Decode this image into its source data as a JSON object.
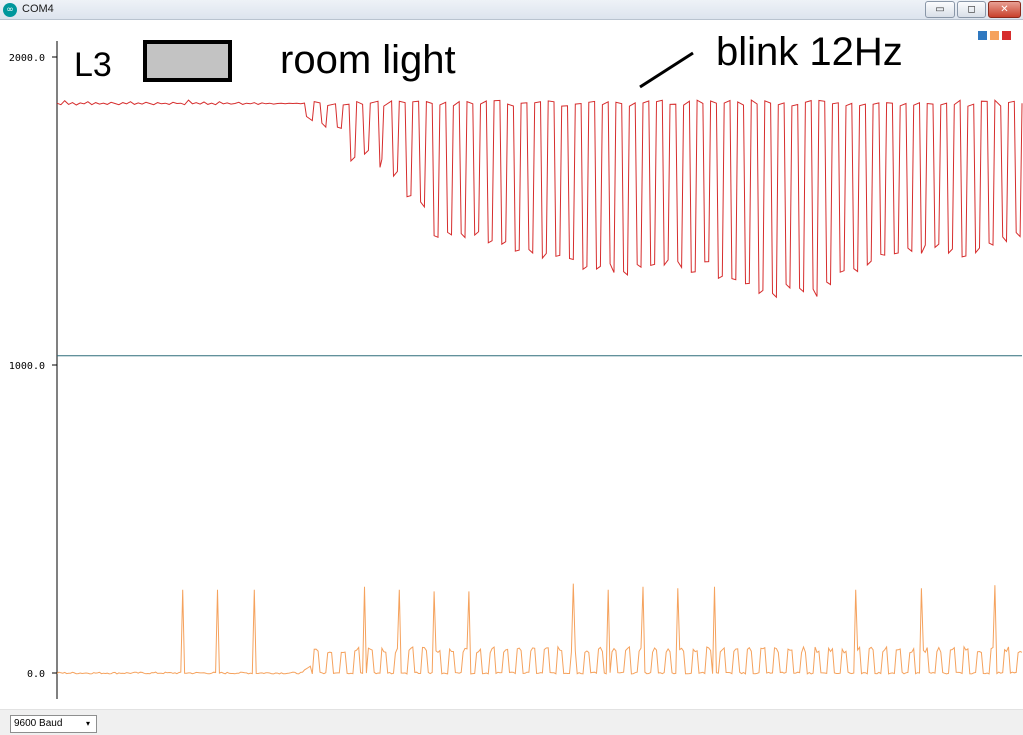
{
  "window": {
    "title": "COM4",
    "minimize_glyph": "▭",
    "maximize_glyph": "◻",
    "close_glyph": "✕"
  },
  "colors": {
    "titlebar": "#dde4ee",
    "series_red": "#d62d2d",
    "series_orange": "#f5a25d",
    "series_blue": "#2f78c0",
    "midline": "#2f6d7a",
    "swatch_fill": "#c3c3c3"
  },
  "icons": [
    "arduino-icon",
    "minimize-icon",
    "maximize-icon",
    "close-icon",
    "dropdown-arrow-icon"
  ],
  "annotations": {
    "label_l3": "L3",
    "room_light": "room light",
    "blink": "blink 12Hz"
  },
  "footer": {
    "baud": "9600 Baud",
    "arrow": "▾"
  },
  "chart_data": {
    "type": "line",
    "title": "",
    "xlabel": "",
    "ylabel": "",
    "ylim": [
      -80,
      2040
    ],
    "xlim": [
      0,
      499
    ],
    "yticks": [
      0,
      1000,
      2000
    ],
    "ytick_labels": [
      "0.0",
      "1000.0",
      "2000.0"
    ],
    "horizontal_lines": [
      1030
    ],
    "legend": {
      "placement": "top-right",
      "colors": [
        "#2f78c0",
        "#f5a25d",
        "#d62d2d"
      ]
    },
    "grid": false,
    "series": [
      {
        "color": "#d62d2d",
        "segments": [
          [
            0,
            1850
          ],
          [
            2,
            1845
          ],
          [
            4,
            1858
          ],
          [
            6,
            1846
          ],
          [
            8,
            1852
          ],
          [
            10,
            1844
          ],
          [
            12,
            1851
          ],
          [
            14,
            1848
          ],
          [
            16,
            1855
          ],
          [
            18,
            1845
          ],
          [
            20,
            1852
          ],
          [
            22,
            1847
          ],
          [
            24,
            1850
          ],
          [
            26,
            1846
          ],
          [
            28,
            1853
          ],
          [
            30,
            1849
          ],
          [
            32,
            1845
          ],
          [
            34,
            1852
          ],
          [
            36,
            1848
          ],
          [
            38,
            1855
          ],
          [
            40,
            1846
          ],
          [
            42,
            1851
          ],
          [
            44,
            1847
          ],
          [
            46,
            1853
          ],
          [
            48,
            1849
          ],
          [
            50,
            1845
          ],
          [
            52,
            1852
          ],
          [
            54,
            1848
          ],
          [
            56,
            1850
          ],
          [
            58,
            1846
          ],
          [
            60,
            1853
          ],
          [
            62,
            1849
          ],
          [
            64,
            1850
          ],
          [
            66,
            1845
          ],
          [
            68,
            1860
          ],
          [
            70,
            1848
          ],
          [
            72,
            1852
          ],
          [
            74,
            1847
          ],
          [
            76,
            1854
          ],
          [
            78,
            1846
          ],
          [
            80,
            1850
          ],
          [
            82,
            1845
          ],
          [
            84,
            1855
          ],
          [
            86,
            1848
          ],
          [
            88,
            1851
          ],
          [
            90,
            1847
          ],
          [
            92,
            1849
          ],
          [
            94,
            1853
          ],
          [
            96,
            1846
          ],
          [
            98,
            1850
          ],
          [
            100,
            1848
          ],
          [
            102,
            1852
          ],
          [
            104,
            1846
          ],
          [
            106,
            1851
          ],
          [
            108,
            1848
          ],
          [
            110,
            1850
          ],
          [
            112,
            1847
          ],
          [
            114,
            1849
          ],
          [
            116,
            1850
          ],
          [
            118,
            1848
          ],
          [
            120,
            1850
          ],
          [
            122,
            1849
          ],
          [
            124,
            1850
          ],
          [
            126,
            1848
          ]
        ],
        "bursts": {
          "comment_free_structure": "each burst = [x_start, x_end, low_value]",
          "list": [
            [
              128,
              133,
              1790
            ],
            [
              136,
              140,
              1770
            ],
            [
              144,
              148,
              1760
            ],
            [
              151,
              155,
              1660
            ],
            [
              158,
              162,
              1680
            ],
            [
              166,
              169,
              1640
            ],
            [
              173,
              177,
              1600
            ],
            [
              180,
              184,
              1530
            ],
            [
              187,
              191,
              1500
            ],
            [
              194,
              198,
              1410
            ],
            [
              201,
              205,
              1420
            ],
            [
              208,
              212,
              1400
            ],
            [
              215,
              219,
              1410
            ],
            [
              222,
              226,
              1390
            ],
            [
              229,
              233,
              1380
            ],
            [
              236,
              240,
              1360
            ],
            [
              243,
              247,
              1350
            ],
            [
              250,
              254,
              1340
            ],
            [
              257,
              261,
              1330
            ],
            [
              264,
              268,
              1320
            ],
            [
              271,
              275,
              1310
            ],
            [
              278,
              282,
              1300
            ],
            [
              285,
              289,
              1300
            ],
            [
              292,
              296,
              1290
            ],
            [
              299,
              303,
              1300
            ],
            [
              306,
              310,
              1300
            ],
            [
              313,
              317,
              1320
            ],
            [
              320,
              324,
              1310
            ],
            [
              327,
              331,
              1300
            ],
            [
              334,
              338,
              1310
            ],
            [
              341,
              345,
              1280
            ],
            [
              348,
              352,
              1270
            ],
            [
              355,
              359,
              1260
            ],
            [
              362,
              366,
              1230
            ],
            [
              369,
              373,
              1220
            ],
            [
              376,
              380,
              1240
            ],
            [
              383,
              387,
              1230
            ],
            [
              390,
              394,
              1220
            ],
            [
              397,
              401,
              1260
            ],
            [
              404,
              408,
              1290
            ],
            [
              411,
              415,
              1300
            ],
            [
              418,
              422,
              1310
            ],
            [
              425,
              429,
              1330
            ],
            [
              432,
              436,
              1340
            ],
            [
              439,
              443,
              1350
            ],
            [
              446,
              450,
              1360
            ],
            [
              453,
              457,
              1370
            ],
            [
              460,
              464,
              1350
            ],
            [
              467,
              471,
              1340
            ],
            [
              474,
              478,
              1360
            ],
            [
              481,
              485,
              1380
            ],
            [
              488,
              492,
              1400
            ],
            [
              495,
              499,
              1410
            ]
          ],
          "high_value": 1860
        }
      },
      {
        "color": "#f5a25d",
        "baseline": 0,
        "spikes": [
          [
            65,
            270
          ],
          [
            83,
            270
          ],
          [
            102,
            270
          ],
          [
            159,
            280
          ],
          [
            177,
            270
          ],
          [
            195,
            265
          ],
          [
            213,
            265
          ],
          [
            267,
            290
          ],
          [
            285,
            270
          ],
          [
            303,
            280
          ],
          [
            321,
            275
          ],
          [
            340,
            280
          ],
          [
            413,
            270
          ],
          [
            447,
            275
          ],
          [
            485,
            285
          ]
        ],
        "pulses_start": 132,
        "pulse_period": 7,
        "pulse_height": 75
      }
    ]
  }
}
